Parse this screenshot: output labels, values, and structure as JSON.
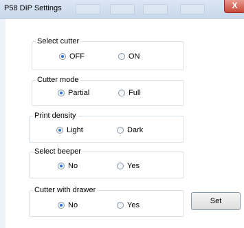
{
  "window": {
    "title": "P58 DIP Settings",
    "close_symbol": "X"
  },
  "groups": [
    {
      "label": "Select cutter",
      "options": [
        {
          "label": "OFF",
          "selected": true
        },
        {
          "label": "ON",
          "selected": false
        }
      ]
    },
    {
      "label": "Cutter mode",
      "options": [
        {
          "label": "Partial",
          "selected": true
        },
        {
          "label": "Full",
          "selected": false
        }
      ]
    },
    {
      "label": "Print density",
      "options": [
        {
          "label": "Light",
          "selected": true
        },
        {
          "label": "Dark",
          "selected": false
        }
      ]
    },
    {
      "label": "Select beeper",
      "options": [
        {
          "label": "No",
          "selected": true
        },
        {
          "label": "Yes",
          "selected": false
        }
      ]
    },
    {
      "label": "Cutter with drawer",
      "options": [
        {
          "label": "No",
          "selected": true
        },
        {
          "label": "Yes",
          "selected": false
        }
      ]
    }
  ],
  "buttons": {
    "set_label": "Set"
  },
  "colors": {
    "accent": "#2a6fd1",
    "group_border": "#d5dfe5"
  }
}
